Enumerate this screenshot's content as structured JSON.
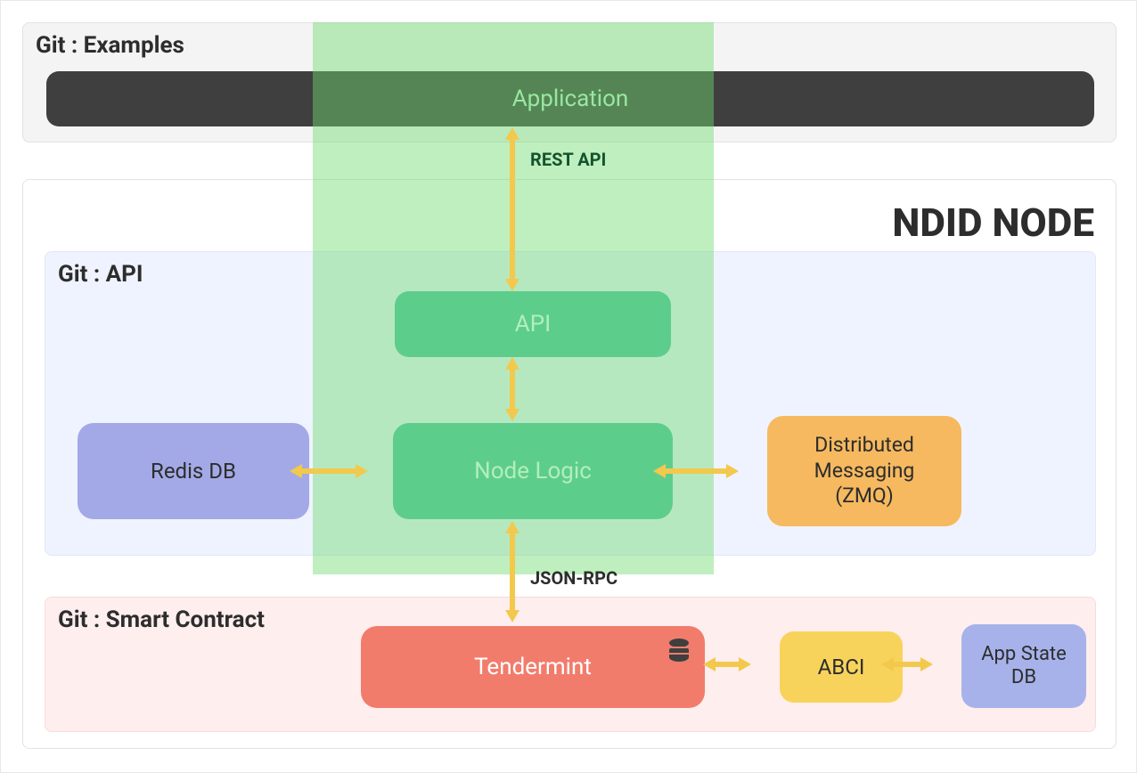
{
  "outerPanels": {
    "examples": {
      "title": "Git : Examples"
    },
    "ndid": {
      "title": "NDID NODE"
    },
    "api": {
      "title": "Git : API"
    },
    "smart": {
      "title": "Git : Smart Contract"
    }
  },
  "boxes": {
    "application": "Application",
    "api": "API",
    "nodeLogic": "Node Logic",
    "redis": "Redis DB",
    "distributed_line1": "Distributed",
    "distributed_line2": "Messaging",
    "distributed_line3": "(ZMQ)",
    "tendermint": "Tendermint",
    "abci": "ABCI",
    "appstate_line1": "App State",
    "appstate_line2": "DB"
  },
  "labels": {
    "restapi": "REST API",
    "jsonrpc": "JSON-RPC"
  },
  "colors": {
    "greyPanel": "#f4f4f4",
    "bluePanel": "#eff3ff",
    "pinkPanel": "#ffeeee",
    "darkBox": "#3f3f3f",
    "tealBox": "#4dc1a2",
    "lilacBox": "#a3a9e6",
    "orangeBox": "#f6b95f",
    "coralBox": "#f27c6c",
    "yellowBox": "#f8d35b",
    "lilac2": "#a7b2ea",
    "overlay": "rgba(112,219,112,0.45)",
    "arrow": "#f2c94c",
    "applicationText": "#b6f2c9",
    "overlayDarkText": "#14532d"
  }
}
